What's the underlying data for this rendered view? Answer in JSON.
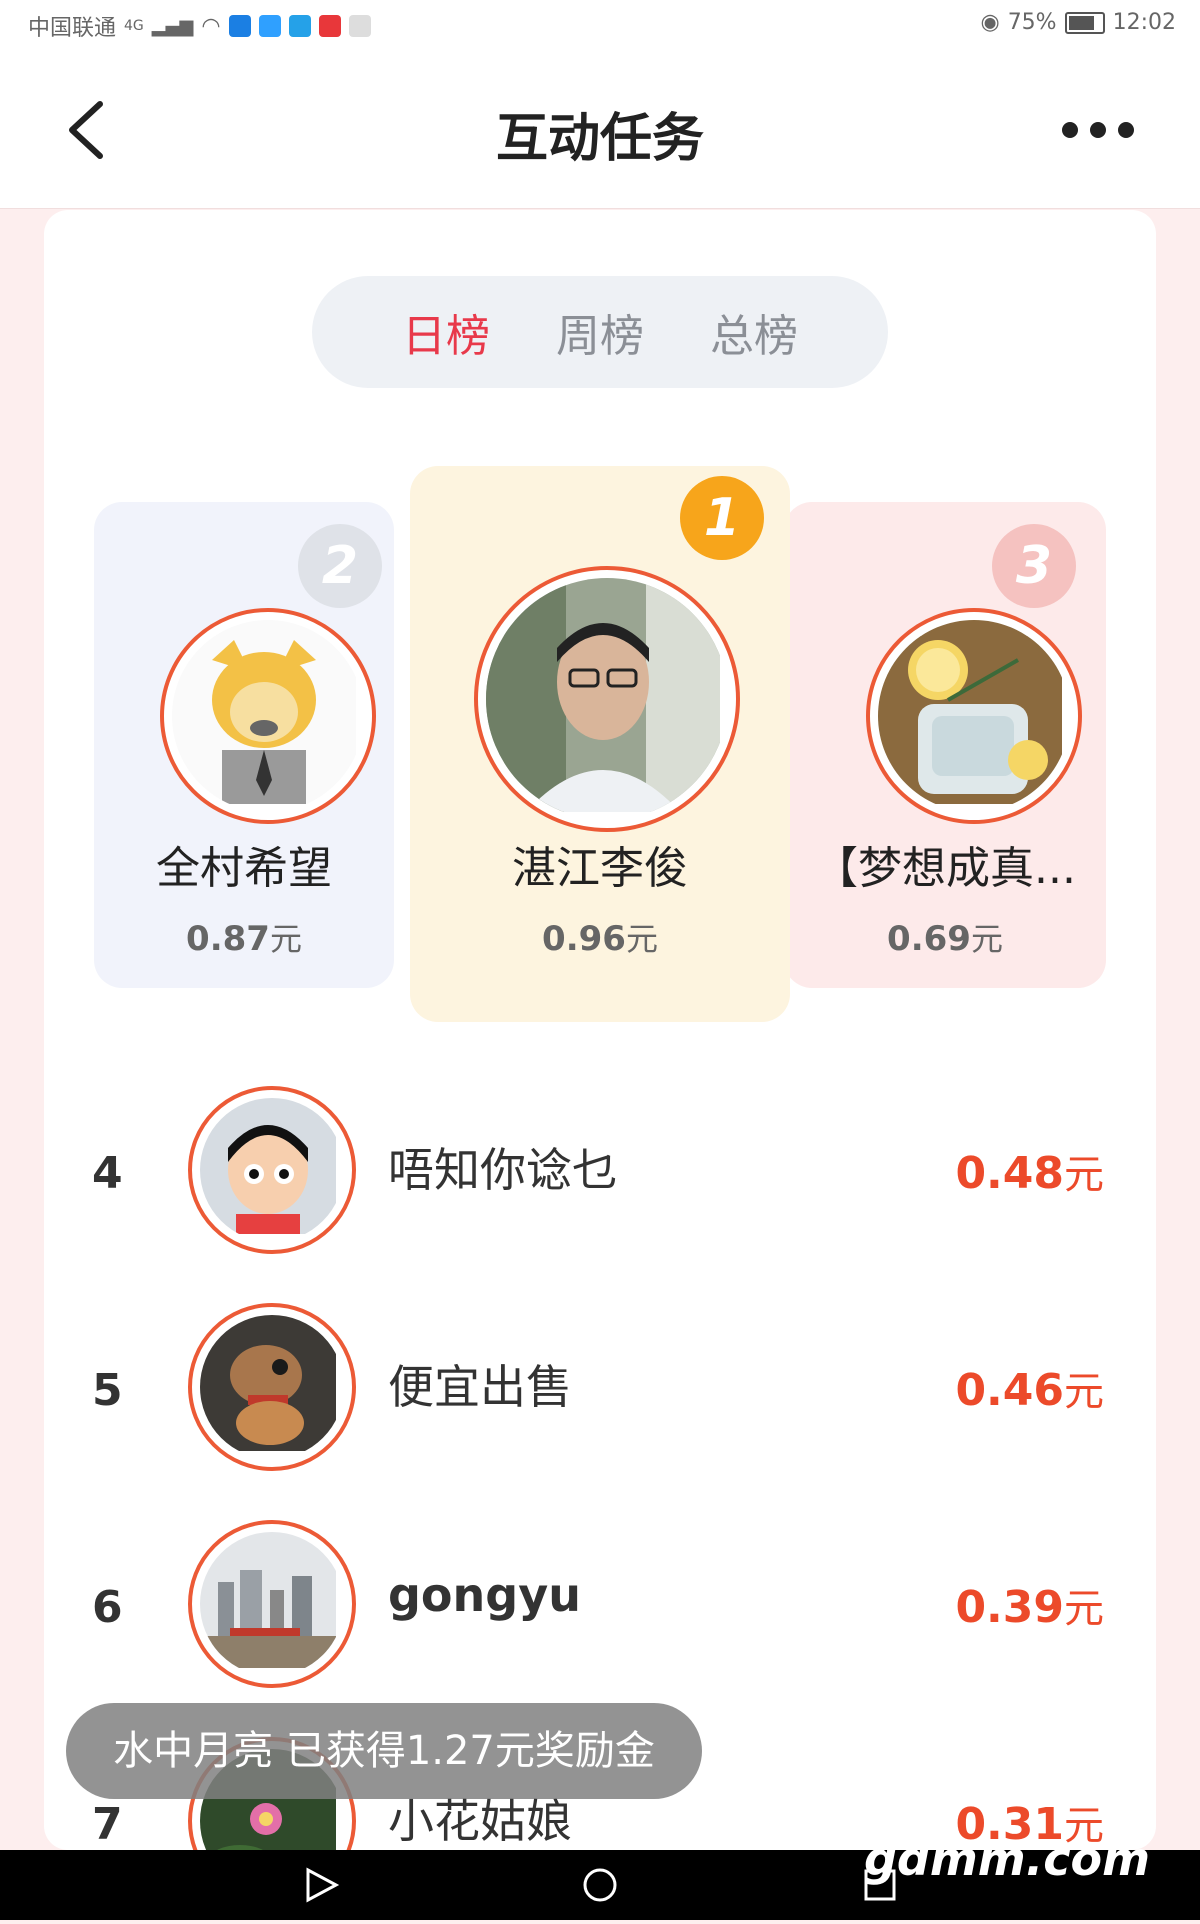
{
  "status_bar": {
    "carrier": "中国联通",
    "network": "4G",
    "battery": "75%",
    "time": "12:02"
  },
  "header": {
    "title": "互动任务"
  },
  "tabs": [
    {
      "label": "日榜",
      "active": true
    },
    {
      "label": "周榜",
      "active": false
    },
    {
      "label": "总榜",
      "active": false
    }
  ],
  "podium": {
    "first": {
      "rank": "1",
      "name": "湛江李俊",
      "amount": "0.96",
      "unit": "元"
    },
    "second": {
      "rank": "2",
      "name": "全村希望",
      "amount": "0.87",
      "unit": "元"
    },
    "third": {
      "rank": "3",
      "name": "【梦想成真...",
      "amount": "0.69",
      "unit": "元"
    }
  },
  "ranking": [
    {
      "rank": "4",
      "name": "唔知你谂乜",
      "amount": "0.48",
      "unit": "元"
    },
    {
      "rank": "5",
      "name": "便宜出售",
      "amount": "0.46",
      "unit": "元"
    },
    {
      "rank": "6",
      "name": "gongyu",
      "amount": "0.39",
      "unit": "元"
    },
    {
      "rank": "7",
      "name": "小花姑娘",
      "amount": "0.31",
      "unit": "元"
    }
  ],
  "toast": {
    "text": "水中月亮   已获得1.27元奖励金"
  },
  "watermark": "gdmm.com",
  "colors": {
    "accent": "#e8394a",
    "amount": "#ec4a2a",
    "ring": "#ec5a36",
    "gold": "#f7a51b"
  }
}
